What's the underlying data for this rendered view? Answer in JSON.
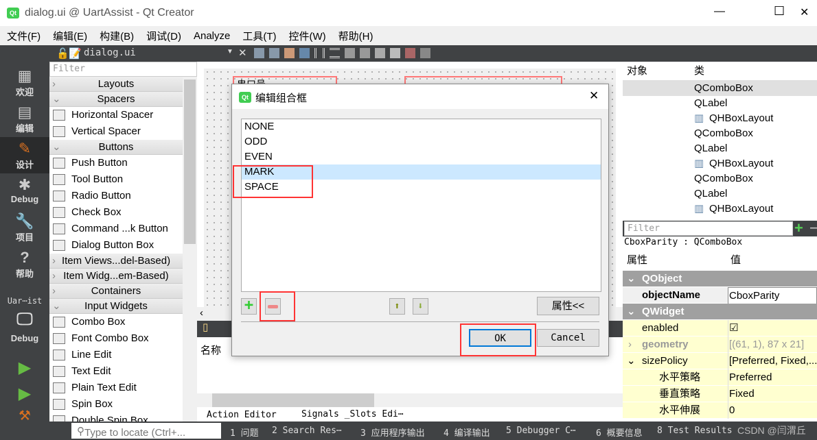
{
  "window": {
    "title": "dialog.ui @ UartAssist - Qt Creator",
    "min": "—",
    "max": "☐",
    "close": "✕"
  },
  "menu": [
    "文件(F)",
    "编辑(E)",
    "构建(B)",
    "调试(D)",
    "Analyze",
    "工具(T)",
    "控件(W)",
    "帮助(H)"
  ],
  "toolbar": {
    "file": "dialog.ui"
  },
  "modes": [
    {
      "label": "欢迎",
      "icon": "grid-icon"
    },
    {
      "label": "编辑",
      "icon": "document-icon"
    },
    {
      "label": "设计",
      "icon": "pencil-icon"
    },
    {
      "label": "Debug",
      "icon": "bug-icon"
    },
    {
      "label": "项目",
      "icon": "wrench-icon"
    },
    {
      "label": "帮助",
      "icon": "help-icon"
    }
  ],
  "kit": {
    "project": "Uar⋯ist",
    "build": "Debug"
  },
  "widgetbox": {
    "filter_placeholder": "Filter",
    "rows": [
      {
        "type": "cat",
        "label": "Layouts",
        "open": false
      },
      {
        "type": "cat",
        "label": "Spacers",
        "open": true
      },
      {
        "type": "item",
        "label": "Horizontal Spacer"
      },
      {
        "type": "item",
        "label": "Vertical Spacer"
      },
      {
        "type": "cat",
        "label": "Buttons",
        "open": true
      },
      {
        "type": "item",
        "label": "Push Button"
      },
      {
        "type": "item",
        "label": "Tool Button"
      },
      {
        "type": "item",
        "label": "Radio Button"
      },
      {
        "type": "item",
        "label": "Check Box"
      },
      {
        "type": "item",
        "label": "Command ...k Button"
      },
      {
        "type": "item",
        "label": "Dialog Button Box"
      },
      {
        "type": "cat",
        "label": "Item Views...del-Based)",
        "open": false
      },
      {
        "type": "cat",
        "label": "Item Widg...em-Based)",
        "open": false
      },
      {
        "type": "cat",
        "label": "Containers",
        "open": false
      },
      {
        "type": "cat",
        "label": "Input Widgets",
        "open": true
      },
      {
        "type": "item",
        "label": "Combo Box"
      },
      {
        "type": "item",
        "label": "Font Combo Box"
      },
      {
        "type": "item",
        "label": "Line Edit"
      },
      {
        "type": "item",
        "label": "Text Edit"
      },
      {
        "type": "item",
        "label": "Plain Text Edit"
      },
      {
        "type": "item",
        "label": "Spin Box"
      },
      {
        "type": "item",
        "label": "Double Spin Box"
      }
    ]
  },
  "canvas": {
    "label": "串口号",
    "action_header": "名称",
    "tabs": [
      "Action Editor",
      "Signals _Slots Edi⋯"
    ]
  },
  "dialog": {
    "title": "编辑组合框",
    "items": [
      "NONE",
      "ODD",
      "EVEN",
      "MARK",
      "SPACE"
    ],
    "selected": "MARK",
    "properties_button": "属性<<",
    "ok": "OK",
    "cancel": "Cancel"
  },
  "objects": {
    "headers": [
      "对象",
      "类"
    ],
    "rows": [
      "QComboBox",
      "QLabel",
      "QHBoxLayout",
      "QComboBox",
      "QLabel",
      "QHBoxLayout",
      "QComboBox",
      "QLabel",
      "QHBoxLayout"
    ]
  },
  "properties": {
    "filter_placeholder": "Filter",
    "class_label": "CboxParity : QComboBox",
    "headers": [
      "属性",
      "值"
    ],
    "rows": [
      {
        "group": true,
        "key": "QObject"
      },
      {
        "key": "objectName",
        "value": "CboxParity",
        "bold": true
      },
      {
        "group": true,
        "key": "QWidget"
      },
      {
        "key": "enabled",
        "value": "☑"
      },
      {
        "key": "geometry",
        "value": "[(61, 1), 87 x 21]",
        "dim": true
      },
      {
        "key": "sizePolicy",
        "value": "[Preferred, Fixed,..."
      },
      {
        "key": "水平策略",
        "value": "Preferred",
        "indent": true
      },
      {
        "key": "垂直策略",
        "value": "Fixed",
        "indent": true
      },
      {
        "key": "水平伸展",
        "value": "0",
        "indent": true
      }
    ]
  },
  "statusbar": {
    "locate_placeholder": "Type to locate (Ctrl+...",
    "panes": [
      "1 问题",
      "2 Search Res⋯",
      "3 应用程序输出",
      "4 编译输出",
      "5 Debugger C⋯",
      "6 概要信息",
      "8 Test Results"
    ],
    "watermark": "CSDN @闫渭丘"
  },
  "colors": {
    "dark": "#404244",
    "highlight": "#cce8ff",
    "annotation": "#ff3333",
    "property_bg": "#ffffd0"
  }
}
